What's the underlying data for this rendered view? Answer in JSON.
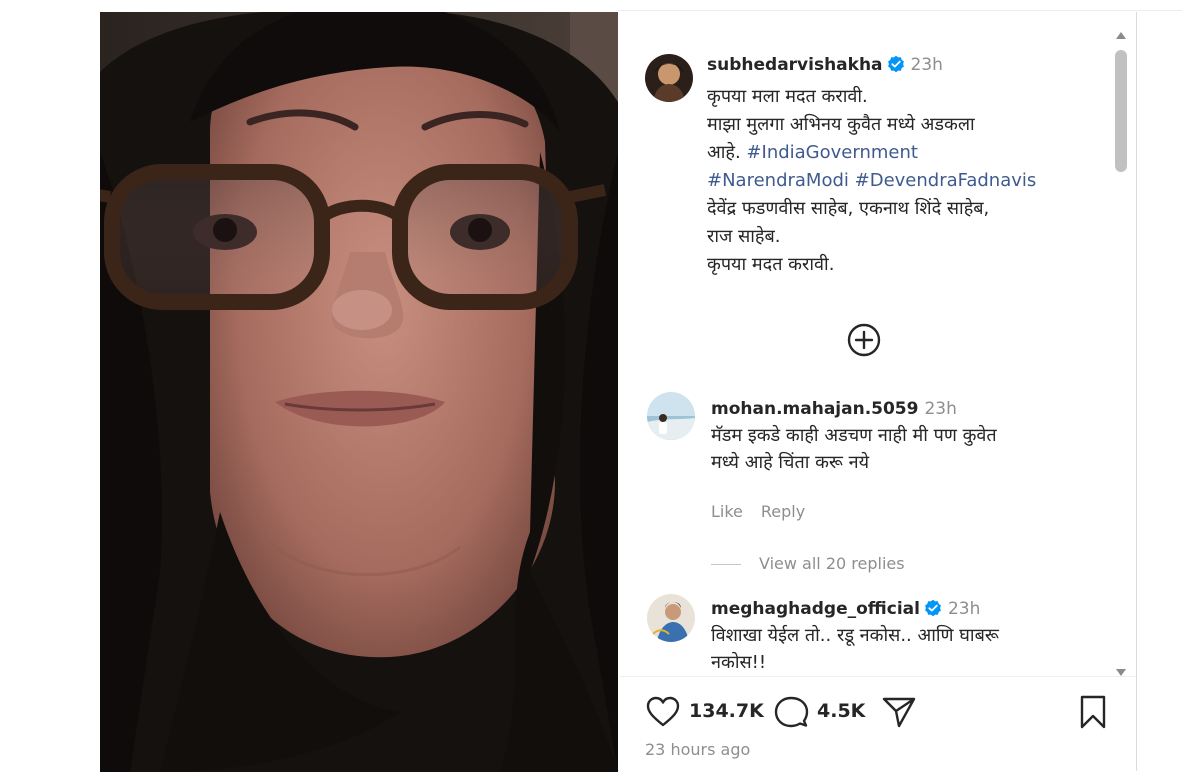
{
  "post": {
    "author": {
      "username": "subhedarvishakha",
      "verified": true,
      "time_ago": "23h"
    },
    "caption_lines": [
      "कृपया मला मदत करावी.",
      "माझा मुलगा अभिनय कुवैत मध्ये अडकला",
      "आहे."
    ],
    "hashtags": [
      "#IndiaGovernment",
      "#NarendraModi",
      "#DevendraFadnavis"
    ],
    "caption_lines_after": [
      "देवेंद्र फडणवीस  साहेब, एकनाथ शिंदे साहेब,",
      "राज साहेब.",
      "कृपया मदत करावी."
    ],
    "add_icon": "plus-circle-icon",
    "likes": "134.7K",
    "comments_count": "4.5K",
    "posted": "23 hours ago"
  },
  "comments": [
    {
      "username": "mohan.mahajan.5059",
      "verified": false,
      "time_ago": "23h",
      "text_lines": [
        "मॅडम इकडे काही अडचण नाही मी पण कुवेत",
        "मध्ये आहे चिंता करू नये"
      ],
      "like_label": "Like",
      "reply_label": "Reply",
      "view_replies": "View all 20 replies"
    },
    {
      "username": "meghaghadge_official",
      "verified": true,
      "time_ago": "23h",
      "text_lines": [
        "विशाखा येईल तो.. रडू नकोस.. आणि घाबरू",
        "नकोस!!"
      ]
    }
  ],
  "icons": {
    "like": "heart-icon",
    "comment": "comment-bubble-icon",
    "share": "send-icon",
    "save": "bookmark-icon",
    "verified": "verified-badge-icon"
  },
  "colors": {
    "hashtag": "#3f5a8f",
    "verified": "#0095f6",
    "muted": "#8e8e8e",
    "text": "#262626"
  }
}
